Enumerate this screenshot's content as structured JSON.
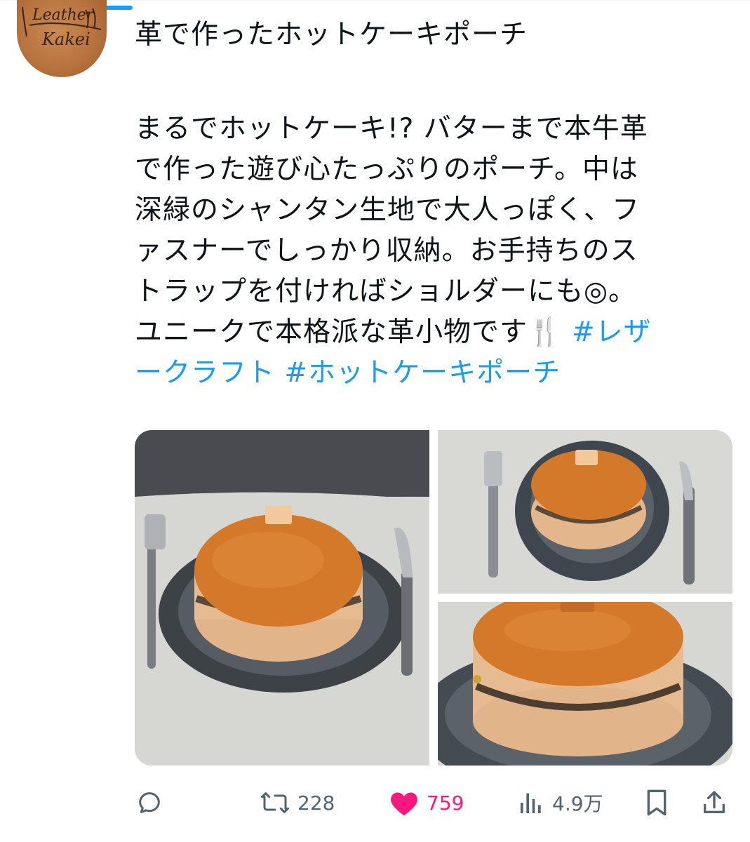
{
  "post": {
    "title": "革で作ったホットケーキポーチ",
    "body": "まるでホットケーキ!? バターまで本牛革\nで作った遊び心たっぷりのポーチ。中は\n深緑のシャンタン生地で大人っぽく、フ\nァスナーでしっかり収納。お手持ちのス\nトラップを付ければショルダーにも◎。\nユニークで本格派な革小物です🍴 ",
    "hashtag1_a": "#レザ",
    "hashtag1_b": "ークラフト",
    "hashtag2": "#ホットケーキポーチ"
  },
  "avatar": {
    "line1": "Leather",
    "line2": "Kakei"
  },
  "actions": {
    "reply_icon": "reply-icon",
    "retweets": "228",
    "likes": "759",
    "views": "4.9万",
    "bookmark_icon": "bookmark-icon",
    "share_icon": "share-icon"
  },
  "colors": {
    "accent": "#1d9bf0",
    "like": "#f91880",
    "muted": "#536471"
  }
}
